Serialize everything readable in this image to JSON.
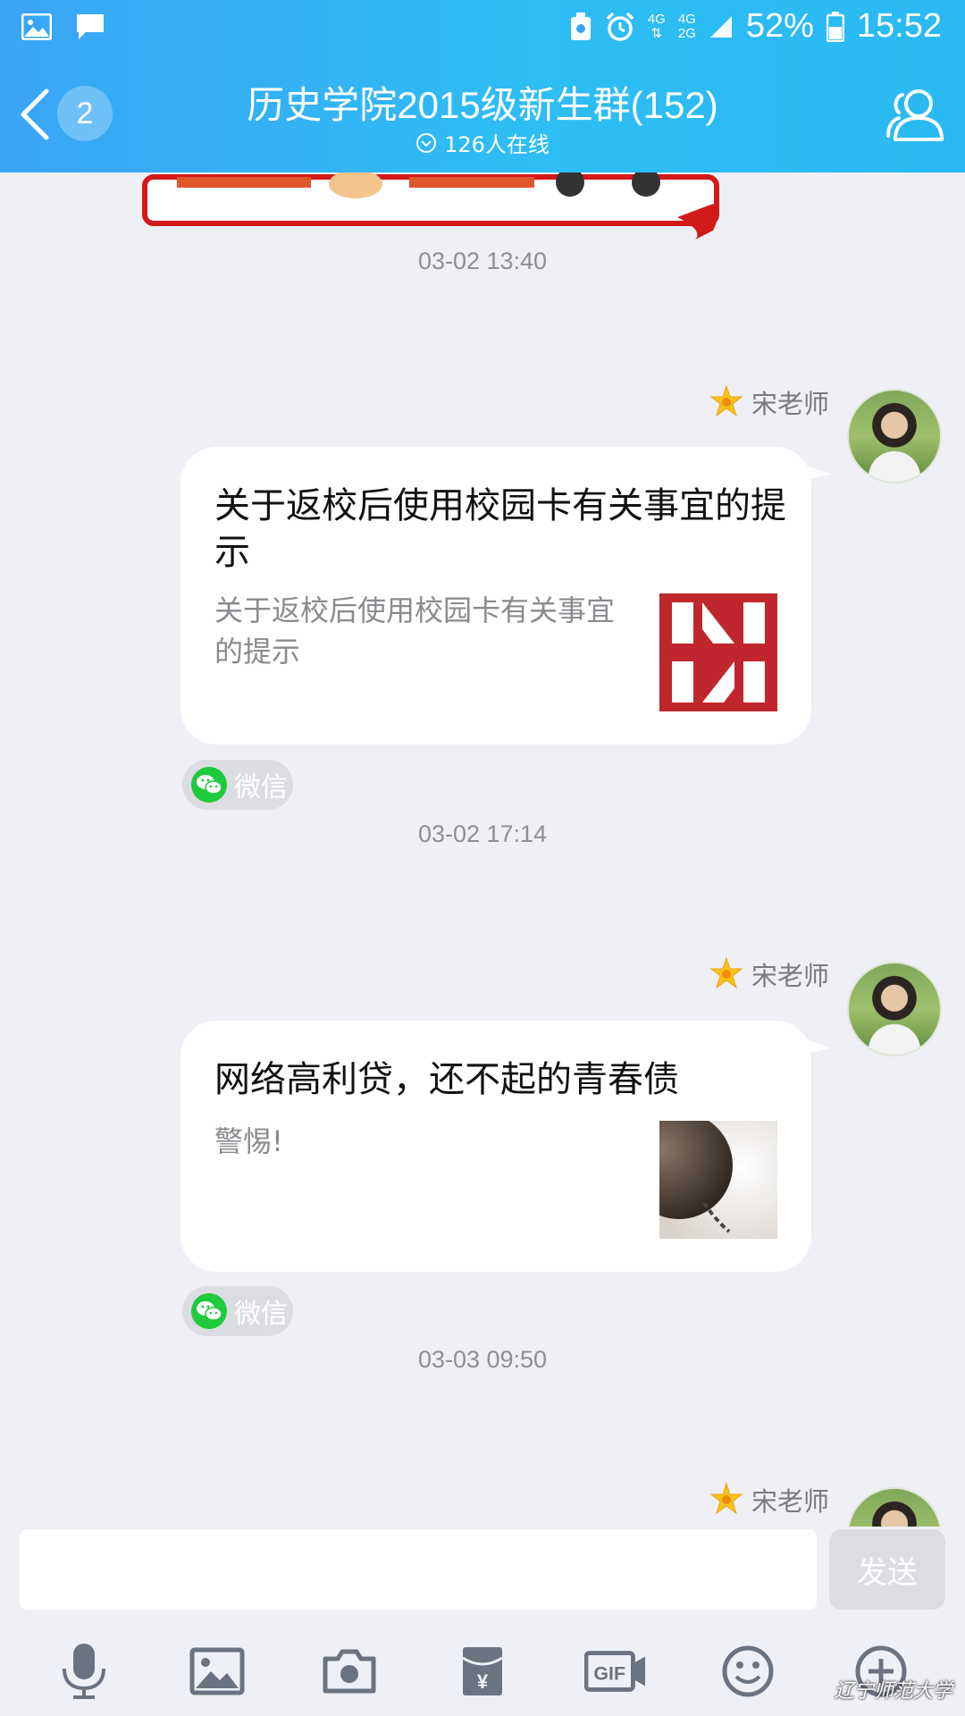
{
  "status_bar": {
    "network_1": "4G",
    "network_2a": "4G",
    "network_2b": "2G",
    "battery": "52%",
    "time": "15:52"
  },
  "header": {
    "unread_count": "2",
    "title": "历史学院2015级新生群(152)",
    "online": "126人在线"
  },
  "messages": [
    {
      "timestamp": "03-02 13:40",
      "sender": "宋老师",
      "title": "关于返校后使用校园卡有关事宜的提示",
      "description": "关于返校后使用校园卡有关事宜的提示",
      "source": "微信",
      "thumb_icon": "lnnu-logo"
    },
    {
      "timestamp": "03-02 17:14",
      "sender": "宋老师",
      "title": "网络高利贷，还不起的青春债",
      "description": "警惕!",
      "source": "微信",
      "thumb_icon": "ball-chain-photo"
    },
    {
      "timestamp": "03-03 09:50",
      "sender": "宋老师"
    }
  ],
  "input": {
    "value": "",
    "send_label": "发送"
  },
  "toolbar": {
    "items": [
      "mic-icon",
      "image-icon",
      "camera-icon",
      "red-packet-icon",
      "gif-icon",
      "emoji-icon",
      "plus-icon"
    ]
  },
  "watermark": "辽宁师范大学",
  "colors": {
    "header_start": "#3aa5f5",
    "header_end": "#2ab9f2",
    "background": "#eef0f5",
    "wechat_green": "#1fcb3c"
  }
}
